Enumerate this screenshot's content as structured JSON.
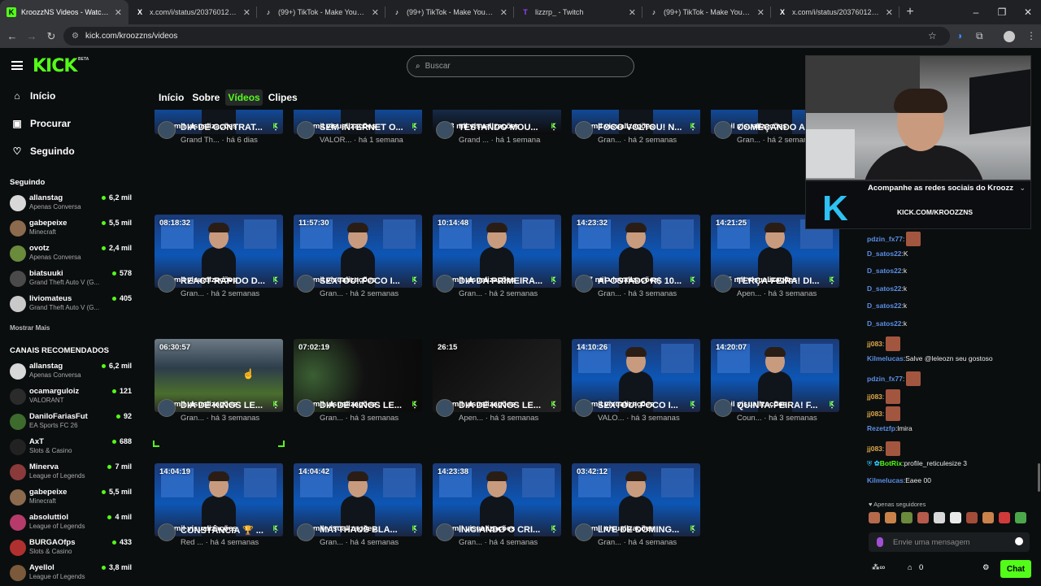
{
  "browser": {
    "tabs": [
      {
        "title": "KroozzNS Videos - Watch On-D",
        "icon": "K",
        "color": "#53fc18",
        "active": true
      },
      {
        "title": "x.com/i/status/20376012475200",
        "icon": "X",
        "color": "#ffffff",
        "active": false
      },
      {
        "title": "(99+) TikTok - Make Your Day",
        "icon": "♪",
        "color": "#ffffff",
        "active": false
      },
      {
        "title": "(99+) TikTok - Make Your Day",
        "icon": "♪",
        "color": "#ffffff",
        "active": false
      },
      {
        "title": "lizzrp_ - Twitch",
        "icon": "T",
        "color": "#9146ff",
        "active": false
      },
      {
        "title": "(99+) TikTok - Make Your Day",
        "icon": "♪",
        "color": "#ffffff",
        "active": false
      },
      {
        "title": "x.com/i/status/20376012475200",
        "icon": "X",
        "color": "#ffffff",
        "active": false
      }
    ],
    "new_tab": "+",
    "url": "kick.com/kroozzns/videos"
  },
  "sidebar": {
    "logo": "KICK",
    "beta": "BETA",
    "nav": [
      {
        "label": "Início",
        "icon": "home-icon",
        "glyph": "⌂"
      },
      {
        "label": "Procurar",
        "icon": "browse-icon",
        "glyph": "▣"
      },
      {
        "label": "Seguindo",
        "icon": "heart-icon",
        "glyph": "♡"
      }
    ],
    "following_title": "Seguindo",
    "following": [
      {
        "name": "allanstag",
        "category": "Apenas Conversa",
        "viewers": "6,2 mil",
        "color": "#d8d8d8"
      },
      {
        "name": "gabepeixe",
        "category": "Minecraft",
        "viewers": "5,5 mil",
        "color": "#8b6a4d"
      },
      {
        "name": "ovotz",
        "category": "Apenas Conversa",
        "viewers": "2,4 mil",
        "color": "#6a8a3c"
      },
      {
        "name": "biatsuuki",
        "category": "Grand Theft Auto V (G...",
        "viewers": "578",
        "color": "#4a4a4a"
      },
      {
        "name": "liviomateus",
        "category": "Grand Theft Auto V (G...",
        "viewers": "405",
        "color": "#c9c9c9"
      }
    ],
    "show_more": "Mostrar Mais",
    "recommended_title": "CANAIS RECOMENDADOS",
    "recommended": [
      {
        "name": "allanstag",
        "category": "Apenas Conversa",
        "viewers": "6,2 mil",
        "color": "#d8d8d8"
      },
      {
        "name": "ocamarguloiz",
        "category": "VALORANT",
        "viewers": "121",
        "color": "#2b2b2b"
      },
      {
        "name": "DaniloFariasFut",
        "category": "EA Sports FC 26",
        "viewers": "92",
        "color": "#3d6b2d"
      },
      {
        "name": "AxT",
        "category": "Slots & Casino",
        "viewers": "688",
        "color": "#222222"
      },
      {
        "name": "Minerva",
        "category": "League of Legends",
        "viewers": "7 mil",
        "color": "#8a3a3a"
      },
      {
        "name": "gabepeixe",
        "category": "Minecraft",
        "viewers": "5,5 mil",
        "color": "#8b6a4d"
      },
      {
        "name": "absoluttiol",
        "category": "League of Legends",
        "viewers": "4 mil",
        "color": "#b63b6a"
      },
      {
        "name": "BURGAOfps",
        "category": "Slots & Casino",
        "viewers": "433",
        "color": "#b03030"
      },
      {
        "name": "Ayellol",
        "category": "League of Legends",
        "viewers": "3,8 mil",
        "color": "#7a5a3a"
      }
    ]
  },
  "search": {
    "placeholder": "Buscar"
  },
  "content_tabs": [
    {
      "label": "Início",
      "active": false
    },
    {
      "label": "Sobre",
      "active": false
    },
    {
      "label": "Vídeos",
      "active": true
    },
    {
      "label": "Clipes",
      "active": false
    }
  ],
  "videos": [
    [
      {
        "duration": "",
        "views": "9,7 mil visualizações",
        "title": "DIA DE CONTRAT...",
        "category": "Grand Th...",
        "age": "há 6 dias",
        "style": "studio"
      },
      {
        "duration": "",
        "views": "8,3 mil visualizações",
        "title": "SEM INTERNET O...",
        "category": "VALOR...",
        "age": "há 1 semana",
        "style": "studio"
      },
      {
        "duration": "",
        "views": "10,3 mil visualizações",
        "title": "TESTANDO MOU...",
        "category": "Grand ...",
        "age": "há 1 semana",
        "style": "off"
      },
      {
        "duration": "",
        "views": "9,8 mil visualizações",
        "title": "FOCO VOLTOU! N...",
        "category": "Gran...",
        "age": "há 2 semanas",
        "style": "studio"
      },
      {
        "duration": "",
        "views": "7 mil visualizações",
        "title": "COMEÇANDO A ...",
        "category": "Gran...",
        "age": "há 2 semanas",
        "style": "studio"
      }
    ],
    [
      {
        "duration": "08:18:32",
        "views": "8,7 mil visualizações",
        "title": "REACT RÁPIDO D...",
        "category": "Gran...",
        "age": "há 2 semanas",
        "style": "studio"
      },
      {
        "duration": "11:57:30",
        "views": "9,9 mil visualizações",
        "title": "SEXTOU! FOCO I...",
        "category": "Gran...",
        "age": "há 2 semanas",
        "style": "studio"
      },
      {
        "duration": "10:14:48",
        "views": "9,5 mil visualizações",
        "title": "DIA DA PRIMEIRA...",
        "category": "Gran...",
        "age": "há 2 semanas",
        "style": "studio"
      },
      {
        "duration": "14:23:32",
        "views": "11,7 mil visualizações",
        "title": "APOSTADO R$ 10...",
        "category": "Gran...",
        "age": "há 3 semanas",
        "style": "studio"
      },
      {
        "duration": "14:21:25",
        "views": "11,5 mil visualizações",
        "title": "TERÇA-FEIRA! DI...",
        "category": "Apen...",
        "age": "há 3 semanas",
        "style": "studio"
      }
    ],
    [
      {
        "duration": "06:30:57",
        "views": "5,6 mil visualizações",
        "title": "DIA DE KINGS LE...",
        "category": "Gran...",
        "age": "há 3 semanas",
        "style": "game"
      },
      {
        "duration": "07:02:19",
        "views": "4,3 mil visualizações",
        "title": "DIA DE KINGS LE...",
        "category": "Gran...",
        "age": "há 3 semanas",
        "style": "green"
      },
      {
        "duration": "26:15",
        "views": "4,3 mil visualizações",
        "title": "DIA DE KINGS LE...",
        "category": "Apen...",
        "age": "há 3 semanas",
        "style": "dark"
      },
      {
        "duration": "14:10:26",
        "views": "5,4 mil visualizações",
        "title": "SEXTOU! FOCO I...",
        "category": "VALO...",
        "age": "há 3 semanas",
        "style": "studio"
      },
      {
        "duration": "14:20:07",
        "views": "7 mil visualizações",
        "title": "QUINTA-FEIRA! F...",
        "category": "Coun...",
        "age": "há 3 semanas",
        "style": "studio"
      }
    ],
    [
      {
        "duration": "14:04:19",
        "views": "8,8 mil visualizações",
        "title": "CONSTÂNCIA 🏆 ...",
        "category": "Red ...",
        "age": "há 4 semanas",
        "style": "studio"
      },
      {
        "duration": "14:04:42",
        "views": "4,6 mil visualizações",
        "title": "MATTHAUS BLA...",
        "category": "Gran...",
        "age": "há 4 semanas",
        "style": "studio"
      },
      {
        "duration": "14:23:38",
        "views": "6,2 mil visualizações",
        "title": "INICIANDO O CRI...",
        "category": "Gran...",
        "age": "há 4 semanas",
        "style": "studio"
      },
      {
        "duration": "03:42:12",
        "views": "2,7 mil visualizações",
        "title": "LIVE DE DOMING...",
        "category": "Gran...",
        "age": "há 4 semanas",
        "style": "studio"
      }
    ]
  ],
  "stream": {
    "social_title": "Acompanhe as redes sociais do Kroozz",
    "social_url": "KICK.COM/KROOZZNS",
    "big_k": "K"
  },
  "chat": {
    "messages": [
      {
        "user": "pdzin_fx77",
        "text": "",
        "color": "#5b8fe6",
        "emote": true
      },
      {
        "user": "D_satos22",
        "text": "K",
        "color": "#5b8fe6",
        "emote": false
      },
      {
        "user": "D_satos22",
        "text": "k",
        "color": "#5b8fe6",
        "emote": false
      },
      {
        "user": "D_satos22",
        "text": "k",
        "color": "#5b8fe6",
        "emote": false
      },
      {
        "user": "D_satos22",
        "text": "k",
        "color": "#5b8fe6",
        "emote": false
      },
      {
        "user": "D_satos22",
        "text": "k",
        "color": "#5b8fe6",
        "emote": false
      },
      {
        "user": "jj083",
        "text": "",
        "color": "#e0a94a",
        "emote": true
      },
      {
        "user": "Kilmelucas",
        "text": "Salve @leleozn seu gostoso",
        "color": "#5b8fe6",
        "emote": false
      },
      {
        "user": "pdzin_fx77",
        "text": "",
        "color": "#5b8fe6",
        "emote": true
      },
      {
        "user": "jj083",
        "text": "",
        "color": "#e0a94a",
        "emote": true
      },
      {
        "user": "jj083",
        "text": "",
        "color": "#e0a94a",
        "emote": true
      },
      {
        "user": "Rezetzfp",
        "text": "lmira",
        "color": "#5b8fe6",
        "emote": false
      },
      {
        "user": "jj083",
        "text": "",
        "color": "#e0a94a",
        "emote": true
      },
      {
        "user": "BotRix",
        "text": "profile_reticulesize 3",
        "color": "#53fc18",
        "emote": false
      },
      {
        "user": "Kilmelucas",
        "text": "Eaee 00",
        "color": "#5b8fe6",
        "emote": false
      }
    ],
    "followers_only": "Apenas seguidores",
    "input_placeholder": "Envie uma mensagem",
    "points": "0",
    "send_label": "Chat"
  }
}
